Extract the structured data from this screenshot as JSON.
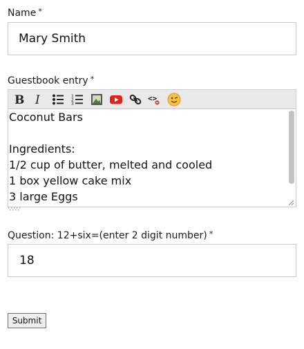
{
  "form": {
    "name": {
      "label": "Name",
      "required_mark": "*",
      "value": "Mary Smith"
    },
    "guestbook": {
      "label": "Guestbook entry",
      "required_mark": "*",
      "toolbar": [
        {
          "icon": "bold-icon"
        },
        {
          "icon": "italic-icon"
        },
        {
          "icon": "bulleted-list-icon"
        },
        {
          "icon": "numbered-list-icon"
        },
        {
          "icon": "image-icon"
        },
        {
          "icon": "youtube-icon"
        },
        {
          "icon": "link-icon"
        },
        {
          "icon": "code-icon"
        },
        {
          "icon": "emoji-icon"
        }
      ],
      "content": "Coconut Bars\n\nIngredients:\n1/2 cup of butter, melted and cooled\n1 box yellow cake mix\n3 large Eggs"
    },
    "question": {
      "label": "Question: 12+six=(enter 2 digit number)",
      "required_mark": "*",
      "value": "18"
    },
    "submit_label": "Submit"
  },
  "colors": {
    "toolbar_bg": "#e9e9e9",
    "youtube_red": "#e62117",
    "emoji_yellow": "#f7c23d"
  }
}
